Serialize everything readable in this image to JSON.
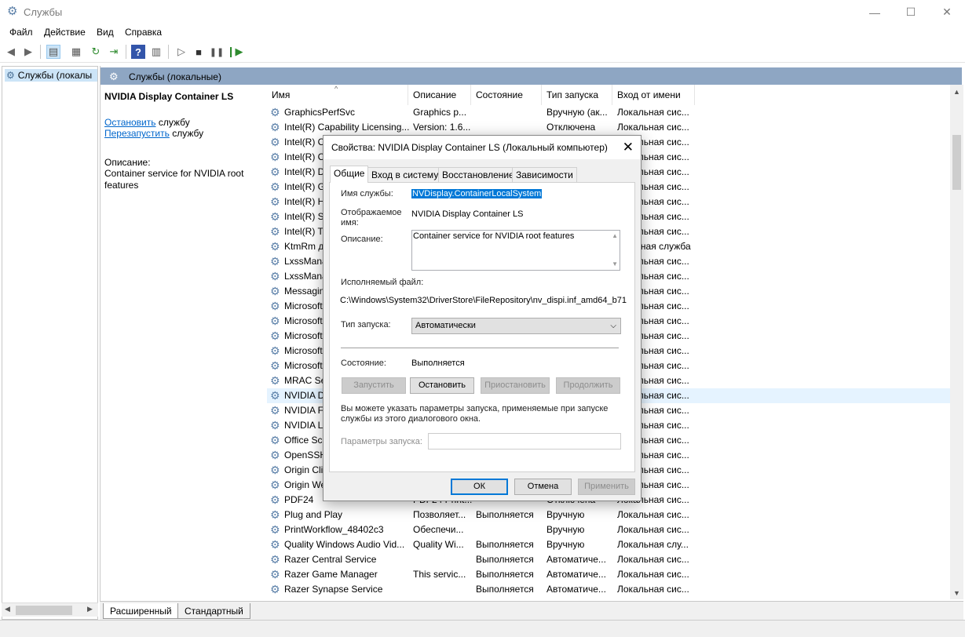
{
  "window": {
    "title": "Службы",
    "icon": "gears-icon",
    "controls": [
      "—",
      "☐",
      "✕"
    ]
  },
  "menu": [
    "Файл",
    "Действие",
    "Вид",
    "Справка"
  ],
  "tree": {
    "root_label": "Службы (локалы"
  },
  "pane": {
    "header": "Службы (локальные)"
  },
  "details": {
    "service_name": "NVIDIA Display Container LS",
    "stop_link": "Остановить",
    "stop_suffix": " службу",
    "restart_link": "Перезапустить",
    "restart_suffix": " службу",
    "description_label": "Описание:",
    "description": "Container service for NVIDIA root features"
  },
  "columns": [
    "Имя",
    "Описание",
    "Состояние",
    "Тип запуска",
    "Вход от имени"
  ],
  "rows": [
    [
      "GraphicsPerfSvc",
      "Graphics p...",
      "",
      "Вручную (ак...",
      "Локальная сис..."
    ],
    [
      "Intel(R) Capability Licensing...",
      "Version: 1.6...",
      "",
      "Отключена",
      "Локальная сис..."
    ],
    [
      "Intel(R) C",
      "",
      "",
      "",
      "Локальная сис..."
    ],
    [
      "Intel(R) C",
      "",
      "",
      "",
      "Локальная сис..."
    ],
    [
      "Intel(R) D",
      "",
      "",
      "",
      "Локальная сис..."
    ],
    [
      "Intel(R) G",
      "",
      "",
      "",
      "Локальная сис..."
    ],
    [
      "Intel(R) H",
      "",
      "",
      "",
      "Локальная сис..."
    ],
    [
      "Intel(R) St",
      "",
      "",
      "",
      "Локальная сис..."
    ],
    [
      "Intel(R) T",
      "",
      "",
      "",
      "Локальная сис..."
    ],
    [
      "KtmRm д",
      "",
      "",
      "",
      "...альная служба"
    ],
    [
      "LxssMana",
      "",
      "",
      "",
      "Локальная сис..."
    ],
    [
      "LxssMana",
      "",
      "",
      "",
      "Локальная сис..."
    ],
    [
      "Messagin",
      "",
      "",
      "",
      "Локальная сис..."
    ],
    [
      "Microsoft",
      "",
      "",
      "",
      "Локальная сис..."
    ],
    [
      "Microsoft",
      "",
      "",
      "",
      "Локальная сис..."
    ],
    [
      "Microsoft",
      "",
      "",
      "",
      "Локальная сис..."
    ],
    [
      "Microsoft",
      "",
      "",
      "",
      "Локальная сис..."
    ],
    [
      "Microsoft",
      "",
      "",
      "",
      "Локальная сис..."
    ],
    [
      "MRAC Se",
      "",
      "",
      "",
      "Локальная сис..."
    ],
    [
      "NVIDIA D",
      "",
      "",
      "",
      "Локальная сис..."
    ],
    [
      "NVIDIA Fr",
      "",
      "",
      "",
      "Локальная сис..."
    ],
    [
      "NVIDIA Lc",
      "",
      "",
      "",
      "Локальная сис..."
    ],
    [
      "Office  Sc",
      "",
      "",
      "",
      "Локальная сис..."
    ],
    [
      "OpenSSH",
      "",
      "",
      "",
      "Локальная сис..."
    ],
    [
      "Origin Cli",
      "",
      "",
      "",
      "Локальная сис..."
    ],
    [
      "Origin We",
      "",
      "",
      "",
      "Локальная сис..."
    ],
    [
      "PDF24",
      "PDF24 Print...",
      "",
      "Отключена",
      "Локальная сис..."
    ],
    [
      "Plug and Play",
      "Позволяет...",
      "Выполняется",
      "Вручную",
      "Локальная сис..."
    ],
    [
      "PrintWorkflow_48402c3",
      "Обеспечи...",
      "",
      "Вручную",
      "Локальная сис..."
    ],
    [
      "Quality Windows Audio Vid...",
      "Quality Wi...",
      "Выполняется",
      "Вручную",
      "Локальная слу..."
    ],
    [
      "Razer Central Service",
      "",
      "Выполняется",
      "Автоматиче...",
      "Локальная сис..."
    ],
    [
      "Razer Game Manager",
      "This servic...",
      "Выполняется",
      "Автоматиче...",
      "Локальная сис..."
    ],
    [
      "Razer Synapse Service",
      "",
      "Выполняется",
      "Автоматиче...",
      "Локальная сис..."
    ],
    [
      "",
      "",
      "",
      "",
      ""
    ]
  ],
  "selected_row": 19,
  "bottom_tabs": [
    "Расширенный",
    "Стандартный"
  ],
  "dialog": {
    "title": "Свойства: NVIDIA Display Container LS (Локальный компьютер)",
    "tabs": [
      "Общие",
      "Вход в систему",
      "Восстановление",
      "Зависимости"
    ],
    "service_name_label": "Имя службы:",
    "service_name": "NVDisplay.ContainerLocalSystem",
    "display_name_label_1": "Отображаемое",
    "display_name_label_2": "имя:",
    "display_name": "NVIDIA Display Container LS",
    "description_label": "Описание:",
    "description": "Container service for NVIDIA root features",
    "exe_label": "Исполняемый файл:",
    "exe_path": "C:\\Windows\\System32\\DriverStore\\FileRepository\\nv_dispi.inf_amd64_b71",
    "startup_label": "Тип запуска:",
    "startup_value": "Автоматически",
    "status_label": "Состояние:",
    "status_value": "Выполняется",
    "btn_start": "Запустить",
    "btn_stop": "Остановить",
    "btn_pause": "Приостановить",
    "btn_resume": "Продолжить",
    "hint_1": "Вы можете указать параметры запуска, применяемые при запуске",
    "hint_2": "службы из этого диалогового окна.",
    "params_label": "Параметры запуска:",
    "ok": "ОК",
    "cancel": "Отмена",
    "apply": "Применить"
  }
}
